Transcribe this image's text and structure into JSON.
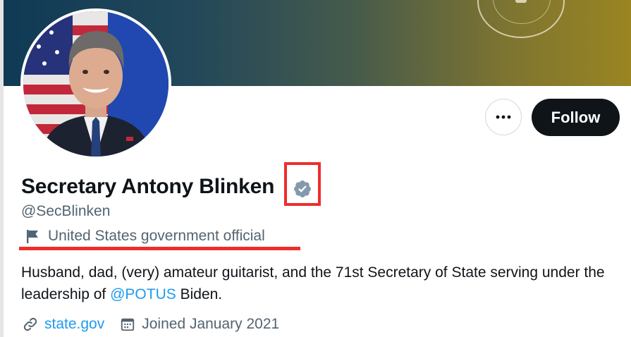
{
  "profile": {
    "display_name": "Secretary Antony Blinken",
    "handle": "@SecBlinken",
    "affiliation": "United States government official",
    "bio_text_1": "Husband, dad, (very) amateur guitarist, and the 71st Secretary of State serving under the leadership of ",
    "bio_mention": "@POTUS",
    "bio_text_2": " Biden.",
    "website": "state.gov",
    "joined": "Joined January 2021"
  },
  "actions": {
    "more_label": "•••",
    "follow_label": "Follow"
  },
  "icons": {
    "verified": "verified-badge-icon",
    "affiliation": "flag-icon",
    "website": "link-icon",
    "joined": "calendar-icon",
    "more": "more-icon"
  },
  "colors": {
    "verified_badge": "#829aab",
    "link": "#1d9bf0",
    "highlight": "#ee2d2d",
    "follow_bg": "#0f1419",
    "secondary_text": "#536471"
  }
}
